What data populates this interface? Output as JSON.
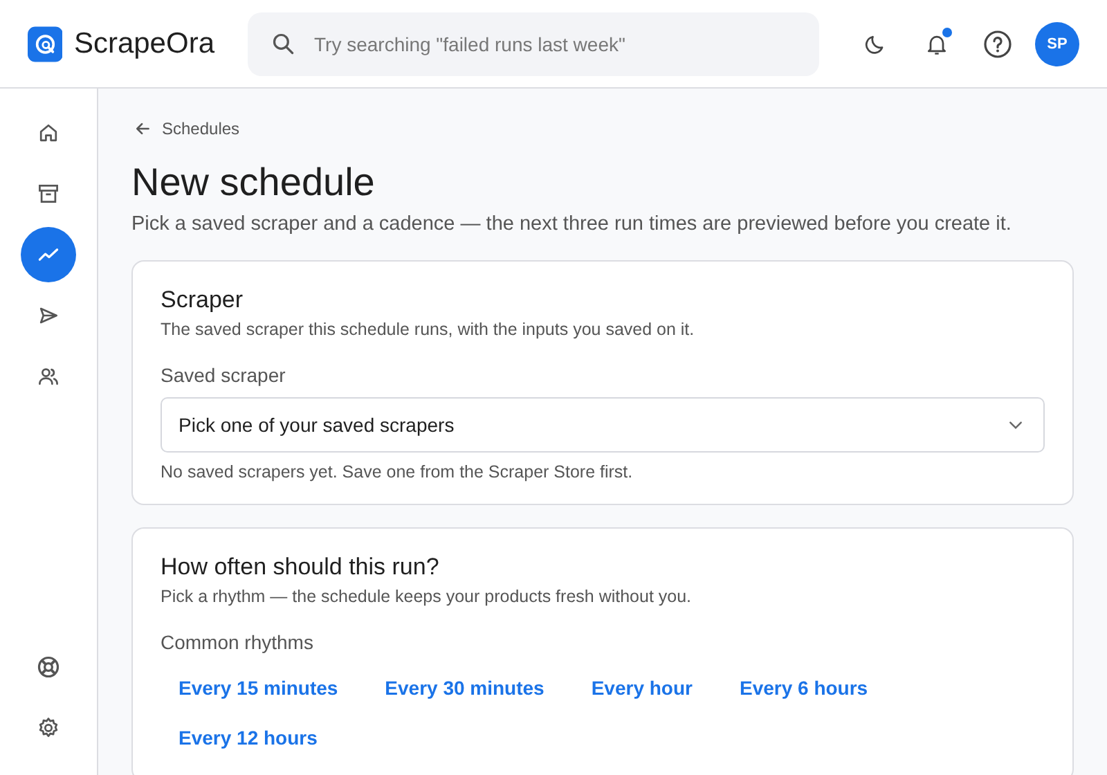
{
  "header": {
    "brand": "ScrapeOra",
    "search": {
      "placeholder": "Try searching \"failed runs last week\""
    },
    "notifications": {
      "unread": true
    },
    "avatar": "SP"
  },
  "sidebar": {
    "items": [
      {
        "kind": "home",
        "selected": false
      },
      {
        "kind": "archive",
        "selected": false
      },
      {
        "kind": "chart",
        "selected": true
      },
      {
        "kind": "send",
        "selected": false
      },
      {
        "kind": "users",
        "selected": false
      }
    ],
    "bottom_items": [
      {
        "kind": "help"
      },
      {
        "kind": "settings"
      }
    ]
  },
  "breadcrumb": "Schedules",
  "page_title": "New schedule",
  "page_subtitle": "Pick a saved scraper and a cadence — the next three run times are previewed before you create it.",
  "scraper_card": {
    "title": "Scraper",
    "description": "The saved scraper this schedule runs, with the inputs you saved on it.",
    "field_label": "Saved scraper",
    "select_placeholder": "Pick one of your saved scrapers",
    "hint": "No saved scrapers yet. Save one from the Scraper Store first."
  },
  "rhythm_card": {
    "title": "How often should this run?",
    "description": "Pick a rhythm — the schedule keeps your products fresh without you.",
    "group_label": "Common rhythms",
    "options": [
      {
        "label": "Every 15 minutes",
        "selected": false
      },
      {
        "label": "Every 30 minutes",
        "selected": false
      },
      {
        "label": "Every hour",
        "selected": false
      },
      {
        "label": "Every 6 hours",
        "selected": false
      },
      {
        "label": "Every 12 hours",
        "selected": false
      }
    ]
  }
}
